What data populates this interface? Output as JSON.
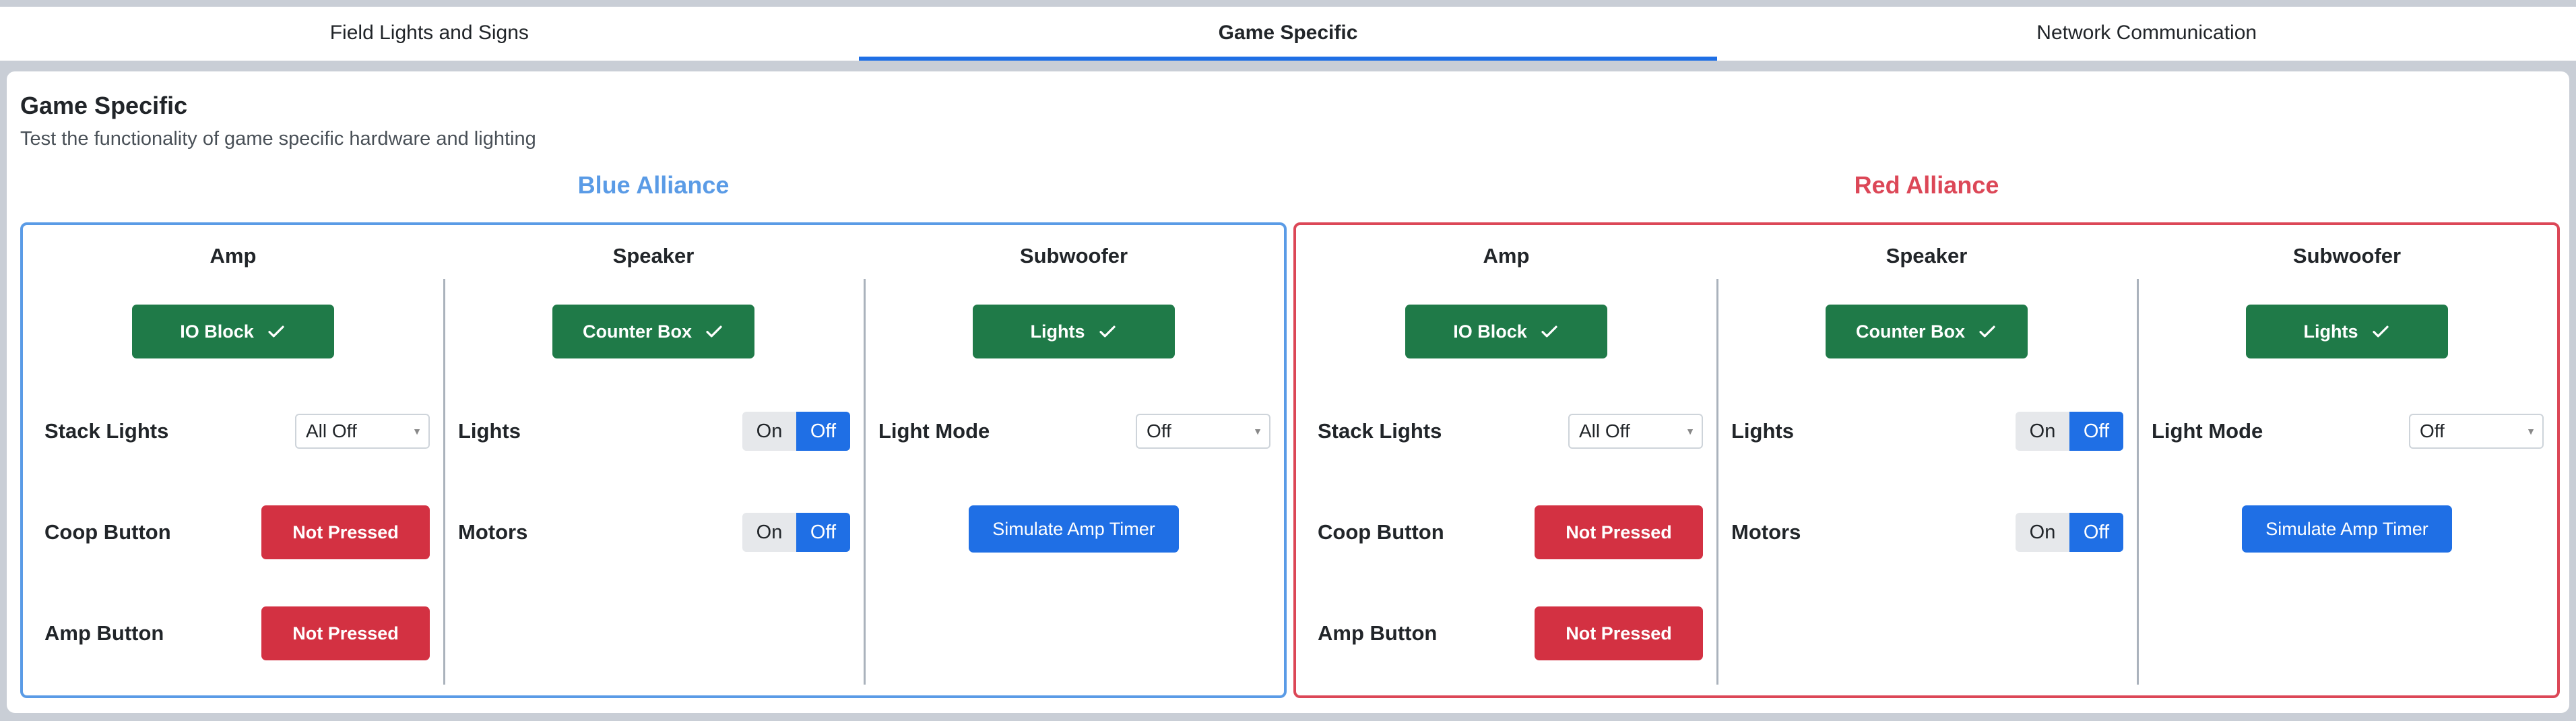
{
  "tabs": [
    {
      "label": "Field Lights and Signs",
      "active": false
    },
    {
      "label": "Game Specific",
      "active": true
    },
    {
      "label": "Network Communication",
      "active": false
    }
  ],
  "page": {
    "title": "Game Specific",
    "subtitle": "Test the functionality of game specific hardware and lighting"
  },
  "alliances": {
    "blue": {
      "title": "Blue Alliance",
      "color": "#5a9be6",
      "amp": {
        "title": "Amp",
        "status_label": "IO Block",
        "stack_lights_label": "Stack Lights",
        "stack_lights_value": "All Off",
        "coop_label": "Coop Button",
        "coop_value": "Not Pressed",
        "amp_button_label": "Amp Button",
        "amp_button_value": "Not Pressed"
      },
      "speaker": {
        "title": "Speaker",
        "status_label": "Counter Box",
        "lights_label": "Lights",
        "motors_label": "Motors",
        "on_label": "On",
        "off_label": "Off"
      },
      "subwoofer": {
        "title": "Subwoofer",
        "status_label": "Lights",
        "light_mode_label": "Light Mode",
        "light_mode_value": "Off",
        "simulate_label": "Simulate Amp Timer"
      }
    },
    "red": {
      "title": "Red Alliance",
      "color": "#dc4757",
      "amp": {
        "title": "Amp",
        "status_label": "IO Block",
        "stack_lights_label": "Stack Lights",
        "stack_lights_value": "All Off",
        "coop_label": "Coop Button",
        "coop_value": "Not Pressed",
        "amp_button_label": "Amp Button",
        "amp_button_value": "Not Pressed"
      },
      "speaker": {
        "title": "Speaker",
        "status_label": "Counter Box",
        "lights_label": "Lights",
        "motors_label": "Motors",
        "on_label": "On",
        "off_label": "Off"
      },
      "subwoofer": {
        "title": "Subwoofer",
        "status_label": "Lights",
        "light_mode_label": "Light Mode",
        "light_mode_value": "Off",
        "simulate_label": "Simulate Amp Timer"
      }
    }
  },
  "icons": {
    "status_check": "check-icon",
    "select_arrow": "chevron-down-icon"
  },
  "colors": {
    "tab_active": "#1f6fe5",
    "status_green": "#1f7a48",
    "not_pressed_red": "#d33142",
    "toggle_active_blue": "#1f6fe5"
  }
}
